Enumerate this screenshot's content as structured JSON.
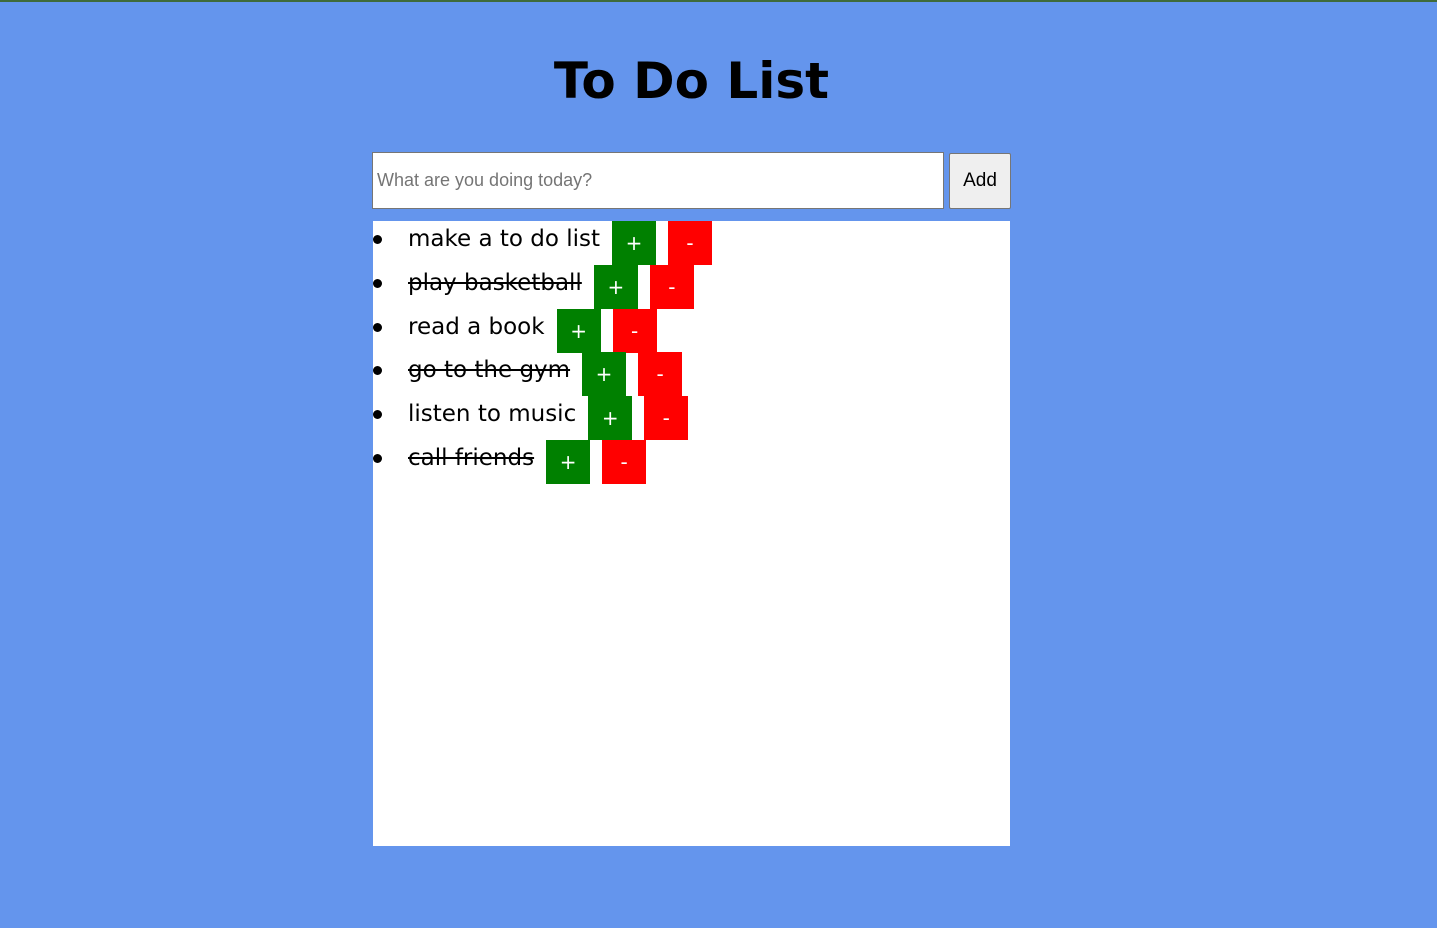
{
  "header": {
    "title": "To Do List"
  },
  "form": {
    "placeholder": "What are you doing today?",
    "value": "",
    "add_label": "Add"
  },
  "tasks": [
    {
      "text": "make a to do list",
      "done": false,
      "complete_label": "+",
      "remove_label": "-"
    },
    {
      "text": "play basketball",
      "done": true,
      "complete_label": "+",
      "remove_label": "-"
    },
    {
      "text": "read a book",
      "done": false,
      "complete_label": "+",
      "remove_label": "-"
    },
    {
      "text": "go to the gym",
      "done": true,
      "complete_label": "+",
      "remove_label": "-"
    },
    {
      "text": "listen to music",
      "done": false,
      "complete_label": "+",
      "remove_label": "-"
    },
    {
      "text": "call friends",
      "done": true,
      "complete_label": "+",
      "remove_label": "-"
    }
  ],
  "colors": {
    "background": "#6495ED",
    "complete_button": "#008000",
    "remove_button": "#FF0000",
    "panel": "#FFFFFF"
  }
}
